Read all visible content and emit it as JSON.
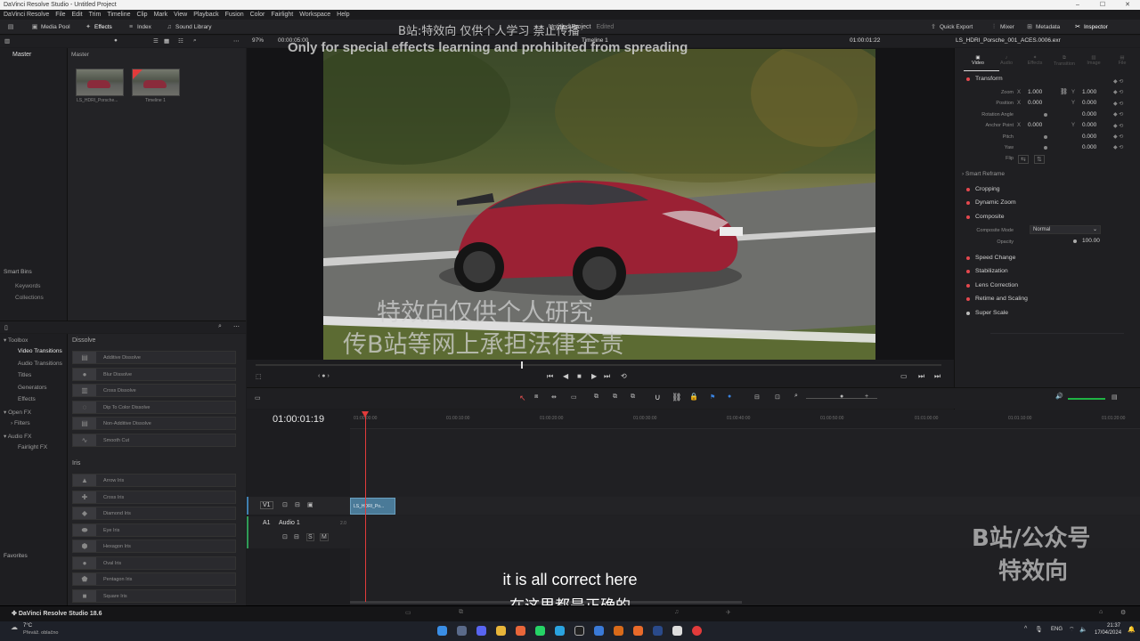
{
  "window": {
    "title": "DaVinci Resolve Studio - Untitled Project"
  },
  "menu": [
    "DaVinci Resolve",
    "File",
    "Edit",
    "Trim",
    "Timeline",
    "Clip",
    "Mark",
    "View",
    "Playback",
    "Fusion",
    "Color",
    "Fairlight",
    "Workspace",
    "Help"
  ],
  "toolbar": {
    "media_pool": "Media Pool",
    "effects": "Effects",
    "index": "Index",
    "sound_library": "Sound Library",
    "project_name": "Untitled Project",
    "edited": "Edited",
    "quick_export": "Quick Export",
    "mixer": "Mixer",
    "metadata": "Metadata",
    "inspector": "Inspector"
  },
  "viewer": {
    "zoom": "97%",
    "duration": "00:00:05:00",
    "timeline_name": "Timeline 1",
    "timecode": "01:00:01:22",
    "clip_name": "LS_HDRI_Porsche_001_ACES.0006.exr"
  },
  "media_pool": {
    "bin_header": "Master",
    "bin_root": "Master",
    "clips": [
      {
        "name": "LS_HDRI_Porsche..."
      },
      {
        "name": "Timeline 1"
      }
    ],
    "smart_bins": "Smart Bins",
    "keywords": "Keywords",
    "collections": "Collections"
  },
  "effects_tree": [
    "Toolbox",
    "Video Transitions",
    "Audio Transitions",
    "Titles",
    "Generators",
    "Effects",
    "Open FX",
    "Filters",
    "Audio FX",
    "Fairlight FX"
  ],
  "favorites": "Favorites",
  "dissolve": {
    "title": "Dissolve",
    "items": [
      "Additive Dissolve",
      "Blur Dissolve",
      "Cross Dissolve",
      "Dip To Color Dissolve",
      "Non-Additive Dissolve",
      "Smooth Cut"
    ]
  },
  "iris": {
    "title": "Iris",
    "items": [
      "Arrow Iris",
      "Cross Iris",
      "Diamond Iris",
      "Eye Iris",
      "Hexagon Iris",
      "Oval Iris",
      "Pentagon Iris",
      "Square Iris"
    ]
  },
  "inspector": {
    "tabs": [
      "Video",
      "Audio",
      "Effects",
      "Transition",
      "Image",
      "File"
    ],
    "transform": "Transform",
    "zoom_label": "Zoom",
    "zoom_x": "1.000",
    "zoom_y": "1.000",
    "position_label": "Position",
    "position_x": "0.000",
    "position_y": "0.000",
    "rotation_label": "Rotation Angle",
    "rotation": "0.000",
    "anchor_label": "Anchor Point",
    "anchor_x": "0.000",
    "anchor_y": "0.000",
    "pitch_label": "Pitch",
    "pitch": "0.000",
    "yaw_label": "Yaw",
    "yaw": "0.000",
    "flip_label": "Flip",
    "smart_reframe": "Smart Reframe",
    "cropping": "Cropping",
    "dynamic_zoom": "Dynamic Zoom",
    "composite": "Composite",
    "composite_mode_label": "Composite Mode",
    "composite_mode": "Normal",
    "opacity_label": "Opacity",
    "opacity": "100.00",
    "speed_change": "Speed Change",
    "stabilization": "Stabilization",
    "lens_correction": "Lens Correction",
    "retime": "Retime and Scaling",
    "super_scale": "Super Scale"
  },
  "timeline": {
    "timecode": "01:00:01:19",
    "ruler": [
      "01:00:00:00",
      "01:00:10:00",
      "01:00:20:00",
      "01:00:30:00",
      "01:00:40:00",
      "01:00:50:00",
      "01:01:00:00",
      "01:01:10:00",
      "01:01:20:00"
    ],
    "v1": "V1",
    "a1": "A1",
    "audio1": "Audio 1",
    "audio_ch": "2.0",
    "clip_label": "LS_HDRI_Po..."
  },
  "overlay": {
    "watermark_top": "B站:特效向 仅供个人学习 禁止传播",
    "watermark_en": "Only for special effects learning and prohibited from spreading",
    "video_cn_1": "特效向仅供个人研究",
    "video_cn_2": "传B站等网上承担法律全责",
    "brand_1": "B站/公众号",
    "brand_2": "特效向",
    "caption_en": "it is all correct here",
    "caption_cn": "在这里都是正确的"
  },
  "app_version": "DaVinci Resolve Studio 18.6",
  "taskbar": {
    "temp": "7°C",
    "weather": "Převáž. oblačno",
    "lang": "ENG",
    "time": "21:37",
    "date": "17/04/2024"
  },
  "colors": {
    "accent_red": "#e4484e",
    "clip_blue": "#4a7a98",
    "playhead": "#e23b3b"
  }
}
